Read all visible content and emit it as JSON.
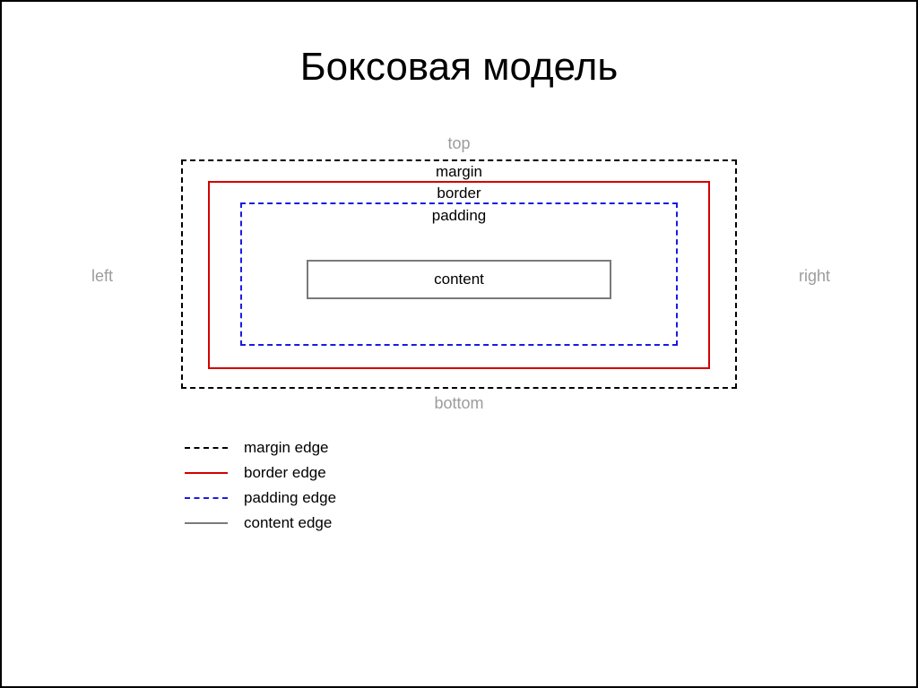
{
  "title": "Боксовая модель",
  "sides": {
    "top": "top",
    "right": "right",
    "bottom": "bottom",
    "left": "left"
  },
  "boxes": {
    "margin": "margin",
    "border": "border",
    "padding": "padding",
    "content": "content"
  },
  "legend": [
    {
      "key": "margin",
      "label": "margin edge"
    },
    {
      "key": "border",
      "label": "border edge"
    },
    {
      "key": "padding",
      "label": "padding edge"
    },
    {
      "key": "content",
      "label": "content edge"
    }
  ],
  "colors": {
    "margin_edge": "#000000",
    "border_edge": "#d40000",
    "padding_edge": "#1a1ae6",
    "content_edge": "#7a7a7a",
    "side_label": "#9c9c9c"
  }
}
